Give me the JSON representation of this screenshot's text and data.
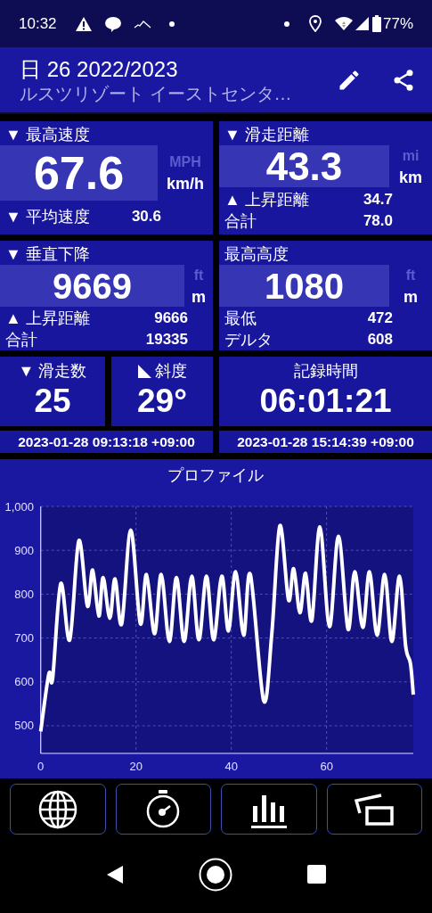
{
  "status_bar": {
    "time": "10:32",
    "battery": "77%"
  },
  "header": {
    "title": "日 26 2022/2023",
    "subtitle": "ルスツリゾート イーストセンタ…"
  },
  "panels": [
    {
      "title": "▼ 最高速度",
      "value": "67.6",
      "units": [
        {
          "label": "MPH",
          "selected": false
        },
        {
          "label": "km/h",
          "selected": true
        }
      ],
      "rows": [
        {
          "label": "▼ 平均速度",
          "value": "30.6"
        }
      ]
    },
    {
      "title": "▼ 滑走距離",
      "value": "43.3",
      "units": [
        {
          "label": "mi",
          "selected": false
        },
        {
          "label": "km",
          "selected": true
        }
      ],
      "rows": [
        {
          "label": "▲ 上昇距離",
          "value": "34.7"
        },
        {
          "label": "合計",
          "value": "78.0"
        }
      ]
    },
    {
      "title": "▼ 垂直下降",
      "value": "9669",
      "units": [
        {
          "label": "ft",
          "selected": false
        },
        {
          "label": "m",
          "selected": true
        }
      ],
      "rows": [
        {
          "label": "▲ 上昇距離",
          "value": "9666"
        },
        {
          "label": "合計",
          "value": "19335"
        }
      ]
    },
    {
      "title": "最高高度",
      "value": "1080",
      "units": [
        {
          "label": "ft",
          "selected": false
        },
        {
          "label": "m",
          "selected": true
        }
      ],
      "rows": [
        {
          "label": "最低",
          "value": "472"
        },
        {
          "label": "デルタ",
          "value": "608"
        }
      ]
    }
  ],
  "small_panels": [
    {
      "kind": "text",
      "title": "▼ 滑走数",
      "value": "25"
    },
    {
      "kind": "slope",
      "title": "斜度",
      "value": "29°"
    },
    {
      "kind": "text",
      "title": "記録時間",
      "value": "06:01:21"
    }
  ],
  "timestamps": [
    "2023-01-28 09:13:18 +09:00",
    "2023-01-28 15:14:39 +09:00"
  ],
  "profile": {
    "chart_data": {
      "type": "line",
      "title": "プロファイル",
      "grid": true,
      "xlim": [
        0,
        78.2
      ],
      "ylim": [
        439,
        1000
      ],
      "xticks": [
        0,
        20,
        40,
        60
      ],
      "yticks": [
        500,
        600,
        700,
        800,
        900,
        {
          "value": 1000,
          "label": "1,000"
        }
      ],
      "x": [
        0,
        1.7,
        2.5,
        4.2,
        6.1,
        8.0,
        9.8,
        10.9,
        12.2,
        13.1,
        14.5,
        15.6,
        17.0,
        18.9,
        20.9,
        22.2,
        23.9,
        25.3,
        27.0,
        28.5,
        30.1,
        31.7,
        33.2,
        34.8,
        36.3,
        38.0,
        39.4,
        40.9,
        42.6,
        44.0,
        46.8,
        48.5,
        50.2,
        52.0,
        53.1,
        54.4,
        55.6,
        56.9,
        58.6,
        60.6,
        62.5,
        64.5,
        65.9,
        67.6,
        69.0,
        70.6,
        72.2,
        73.7,
        75.3,
        76.6,
        77.6,
        78.2
      ],
      "series": [
        {
          "color": "#ffffff",
          "values": [
            487,
            618,
            608,
            824,
            696,
            922,
            773,
            855,
            750,
            838,
            745,
            835,
            732,
            946,
            733,
            845,
            710,
            845,
            692,
            838,
            692,
            841,
            696,
            841,
            696,
            841,
            716,
            851,
            706,
            845,
            557,
            709,
            956,
            787,
            858,
            758,
            848,
            740,
            953,
            726,
            932,
            720,
            851,
            724,
            851,
            706,
            845,
            692,
            841,
            682,
            642,
            571
          ]
        }
      ]
    }
  }
}
